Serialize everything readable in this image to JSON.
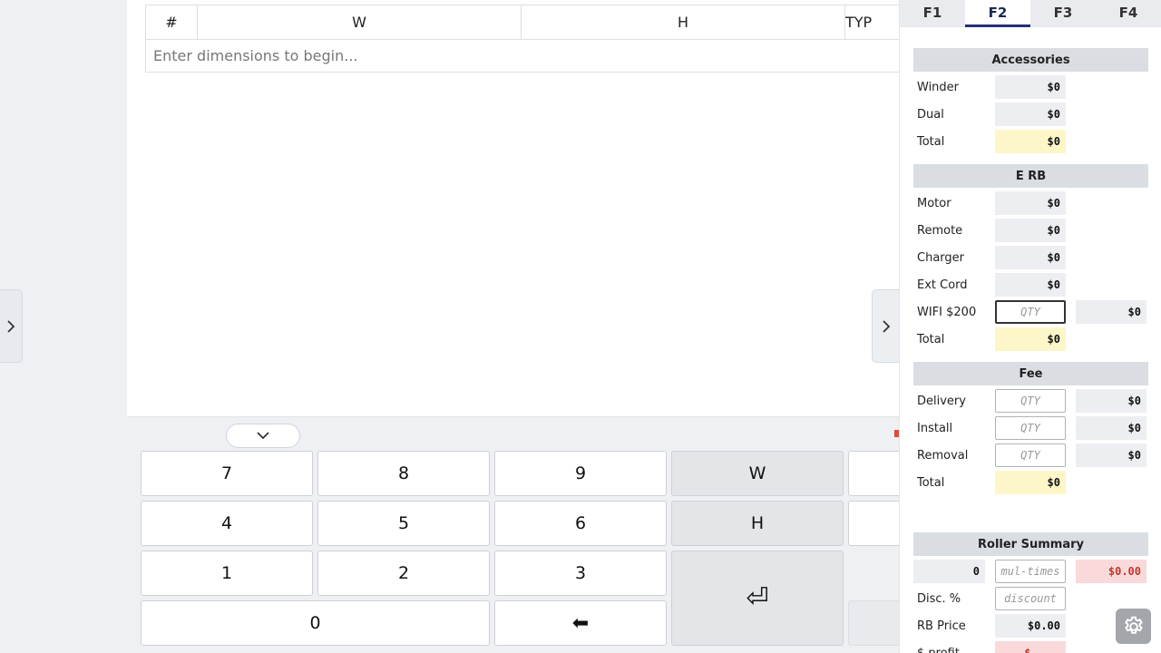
{
  "table": {
    "headers": [
      "#",
      "W",
      "H",
      "TYP"
    ],
    "empty_message": "Enter dimensions to begin..."
  },
  "keypad": {
    "keys": [
      "7",
      "8",
      "9",
      "W",
      "4",
      "5",
      "6",
      "H",
      "1",
      "2",
      "3",
      "0"
    ],
    "enter_glyph": "⏎",
    "backspace_glyph": "⬅"
  },
  "tabs": [
    "F1",
    "F2",
    "F3",
    "F4"
  ],
  "active_tab": "F2",
  "accessories": {
    "title": "Accessories",
    "rows": [
      {
        "label": "Winder",
        "value": "$0"
      },
      {
        "label": "Dual",
        "value": "$0"
      },
      {
        "label": "Total",
        "value": "$0"
      }
    ]
  },
  "erb": {
    "title": "E RB",
    "rows": [
      {
        "label": "Motor",
        "value": "$0"
      },
      {
        "label": "Remote",
        "value": "$0"
      },
      {
        "label": "Charger",
        "value": "$0"
      },
      {
        "label": "Ext Cord",
        "value": "$0"
      }
    ],
    "wifi": {
      "label": "WIFI $200",
      "placeholder": "QTY",
      "value": "$0"
    },
    "total": {
      "label": "Total",
      "value": "$0"
    }
  },
  "fee": {
    "title": "Fee",
    "rows": [
      {
        "label": "Delivery",
        "placeholder": "QTY",
        "value": "$0"
      },
      {
        "label": "Install",
        "placeholder": "QTY",
        "value": "$0"
      },
      {
        "label": "Removal",
        "placeholder": "QTY",
        "value": "$0"
      }
    ],
    "total": {
      "label": "Total",
      "value": "$0"
    }
  },
  "roller_summary": {
    "title": "Roller Summary",
    "count": "0",
    "multiplier_placeholder": "mul-times",
    "amount": "$0.00",
    "disc_label": "Disc. %",
    "disc_placeholder": "discount",
    "rb_price_label": "RB Price",
    "rb_price": "$0.00",
    "profit_label": "$ profit",
    "profit_value": "$"
  },
  "colors": {
    "accent": "#22317a",
    "total_bg": "#fdf6c9",
    "warn": "#c0392b"
  }
}
